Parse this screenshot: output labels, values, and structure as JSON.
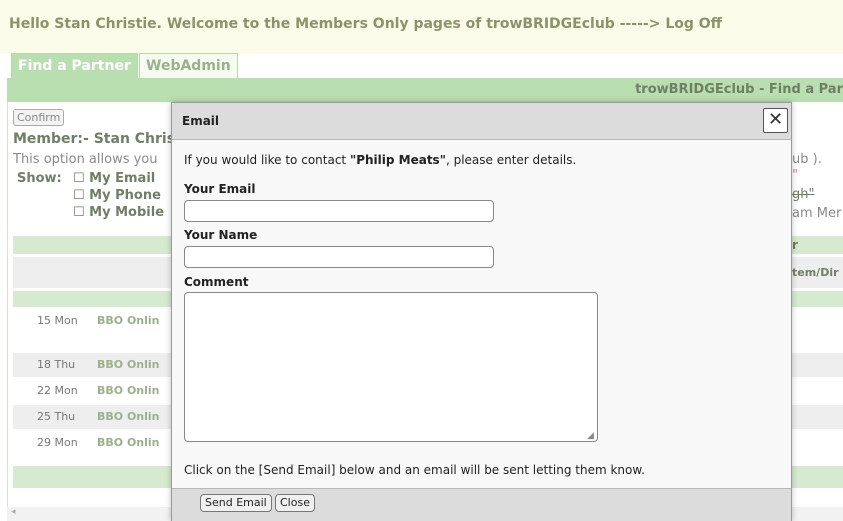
{
  "welcome": {
    "text": "Hello Stan Christie. Welcome to the Members Only pages of trowBRIDGEclub -----> Log Off"
  },
  "tabs": [
    {
      "label": "Find a Partner",
      "active": true
    },
    {
      "label": "WebAdmin",
      "active": false
    }
  ],
  "header": {
    "title": "trowBRIDGEclub - Find a Par"
  },
  "main": {
    "confirm_label": "Confirm",
    "member_text": "Member:- Stan Chris",
    "option_text": "This option allows you",
    "show_label": "Show:",
    "show_options": [
      "☐ My Email",
      "☐ My Phone",
      "☐ My Mobile"
    ],
    "right_fragments": [
      "ub ).",
      "\"",
      "gh\"",
      "am Mer",
      "r",
      "tem/Dir"
    ]
  },
  "rows": [
    {
      "date": "15 Mon",
      "event": "BBO Onlin"
    },
    {
      "date": "18 Thu",
      "event": "BBO Onlin"
    },
    {
      "date": "22 Mon",
      "event": "BBO Onlin"
    },
    {
      "date": "25 Thu",
      "event": "BBO Onlin"
    },
    {
      "date": "29 Mon",
      "event": "BBO Onlin"
    }
  ],
  "modal": {
    "title": "Email",
    "close_symbol": "✕",
    "intro_before": "If you would like to contact ",
    "intro_name": "\"Philip Meats\"",
    "intro_after": ", please enter details.",
    "email_label": "Your Email",
    "email_value": "",
    "name_label": "Your Name",
    "name_value": "",
    "comment_label": "Comment",
    "comment_value": "",
    "note": "Click on the [Send Email] below and an email will be sent letting them know.",
    "send_label": "Send Email",
    "close_label": "Close"
  },
  "colors": {
    "tab_green": "#b9deb0",
    "row_green": "#d6ead0",
    "text_olive": "#8a9466"
  },
  "icons": {
    "close": "close-icon",
    "resize": "resize-grip-icon",
    "scroll_left": "chevron-left-icon"
  }
}
